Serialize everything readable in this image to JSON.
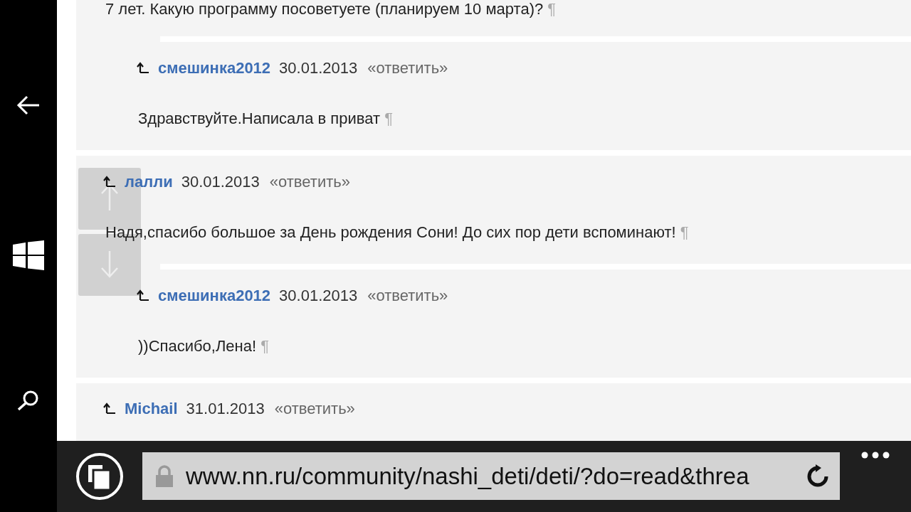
{
  "posts": [
    {
      "text": "7 лет. Какую программу посоветуете (планируем 10 марта)?",
      "mark": "¶",
      "replies": [
        {
          "author": "смешинка2012",
          "date": "30.01.2013",
          "reply_link": "«ответить»",
          "text": "Здравствуйте.Написала в приват",
          "mark": "¶"
        }
      ]
    },
    {
      "author": "лалли",
      "date": "30.01.2013",
      "reply_link": "«ответить»",
      "text": "Надя,спасибо большое за День рождения Сони! До сих пор дети вспоминают!",
      "mark": "¶",
      "replies": [
        {
          "author": "смешинка2012",
          "date": "30.01.2013",
          "reply_link": "«ответить»",
          "text": "))Спасибо,Лена!",
          "mark": "¶"
        }
      ]
    },
    {
      "author": "Michail",
      "date": "31.01.2013",
      "reply_link": "«ответить»"
    }
  ],
  "address_bar": {
    "url": "www.nn.ru/community/nashi_deti/deti/?do=read&threa"
  }
}
